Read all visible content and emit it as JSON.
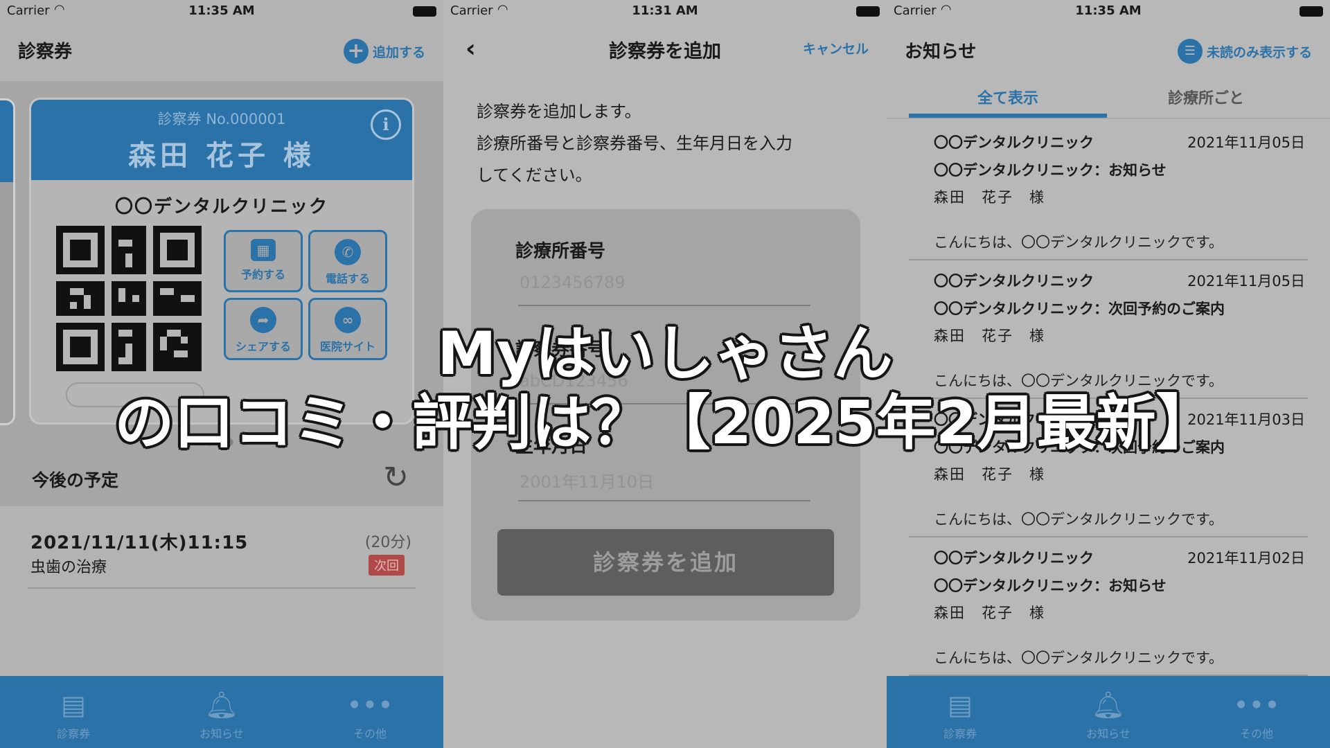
{
  "status": {
    "carrier": "Carrier",
    "time_left": "11:35 AM",
    "time_mid": "11:31 AM",
    "time_right": "11:35 AM"
  },
  "screen1": {
    "title": "診察券",
    "add_label": "追加する",
    "card": {
      "number": "診察券 No.000001",
      "patient": "森田 花子 様",
      "clinic": "〇〇デンタルクリニック",
      "actions": [
        {
          "label": "予約する",
          "icon": "calendar-plus-icon"
        },
        {
          "label": "電話する",
          "icon": "phone-icon"
        },
        {
          "label": "シェアする",
          "icon": "share-icon"
        },
        {
          "label": "医院サイト",
          "icon": "link-icon"
        }
      ]
    },
    "schedule_title": "今後の予定",
    "appointment": {
      "datetime": "2021/11/11(木)11:15",
      "duration": "(20分)",
      "description": "虫歯の治療",
      "badge": "次回"
    },
    "tabbar": [
      {
        "label": "診察券",
        "icon": "card-icon"
      },
      {
        "label": "お知らせ",
        "icon": "bell-icon"
      },
      {
        "label": "その他",
        "icon": "more-icon"
      }
    ]
  },
  "screen2": {
    "title": "診察券を追加",
    "cancel_label": "キャンセル",
    "intro_line1": "診察券を追加します。",
    "intro_line2": "診療所番号と診察券番号、生年月日を入力",
    "intro_line3": "してください。",
    "fields": [
      {
        "label": "診療所番号",
        "placeholder": "0123456789"
      },
      {
        "label": "診察券番号",
        "placeholder": "abCD123456"
      },
      {
        "label": "生年月日",
        "placeholder": "2001年11月10日"
      }
    ],
    "submit_label": "診察券を追加"
  },
  "screen3": {
    "title": "お知らせ",
    "unread_label": "未読のみ表示する",
    "tabs": [
      "全て表示",
      "診療所ごと"
    ],
    "notices": [
      {
        "clinic": "〇〇デンタルクリニック",
        "date": "2021年11月05日",
        "subject": "〇〇デンタルクリニック：お知らせ",
        "to": "森田　花子　様",
        "body": "こんにちは、〇〇デンタルクリニックです。"
      },
      {
        "clinic": "〇〇デンタルクリニック",
        "date": "2021年11月05日",
        "subject": "〇〇デンタルクリニック：次回予約のご案内",
        "to": "森田　花子　様",
        "body": "こんにちは、〇〇デンタルクリニックです。"
      },
      {
        "clinic": "〇〇デンタルクリニック",
        "date": "2021年11月03日",
        "subject": "〇〇デンタルクリニック：次回予約のご案内",
        "to": "森田　花子　様",
        "body": "こんにちは、〇〇デンタルクリニックです。"
      },
      {
        "clinic": "〇〇デンタルクリニック",
        "date": "2021年11月02日",
        "subject": "〇〇デンタルクリニック：お知らせ",
        "to": "森田　花子　様",
        "body": "こんにちは、〇〇デンタルクリニックです。"
      }
    ],
    "tabbar": [
      {
        "label": "診察券",
        "icon": "card-icon"
      },
      {
        "label": "お知らせ",
        "icon": "bell-icon"
      },
      {
        "label": "その他",
        "icon": "more-icon"
      }
    ]
  },
  "headline": {
    "line1": "Myはいしゃさん",
    "line2": "の口コミ・評判は？【2025年2月最新】"
  },
  "colors": {
    "accent": "#2a72a8",
    "badge": "#b04a48"
  }
}
